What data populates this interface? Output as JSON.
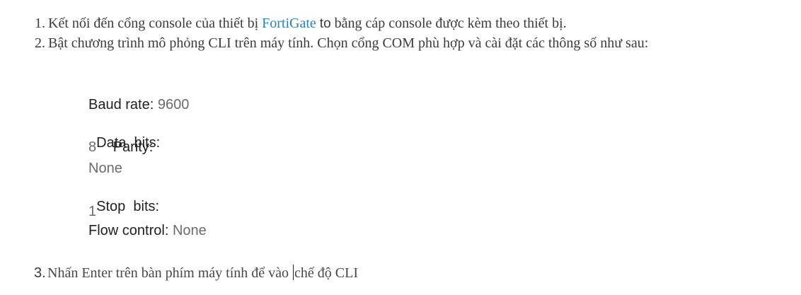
{
  "steps": [
    {
      "number": "1.",
      "text_before": "Kết nối đến cổng console của thiết bị",
      "brand": "FortiGate",
      "word_to": "to",
      "text_after": "bằng cáp console được kèm theo thiết bị."
    },
    {
      "number": "2.",
      "text": "Bật chương trình mô phỏng CLI trên máy tính. Chọn cổng COM phù hợp và cài đặt các thông số như sau:"
    }
  ],
  "settings": {
    "baud_label": "Baud rate:",
    "baud_value": "9600",
    "data_bits_label": "Data  bits:",
    "data_bits_value": "8",
    "parity_label": "Parity:",
    "parity_value": "None",
    "stop_bits_label": "Stop  bits:",
    "stop_bits_value": "1",
    "flow_label": "Flow control:",
    "flow_value": "None"
  },
  "step3": {
    "number": "3.",
    "text_before_caret": "Nhấn Enter trên bàn phím máy tính để vào ",
    "text_after_caret": "chế độ CLI"
  },
  "colors": {
    "brand": "#2e7fb8",
    "text": "#3b3b3b",
    "value": "#6b6b6b"
  }
}
